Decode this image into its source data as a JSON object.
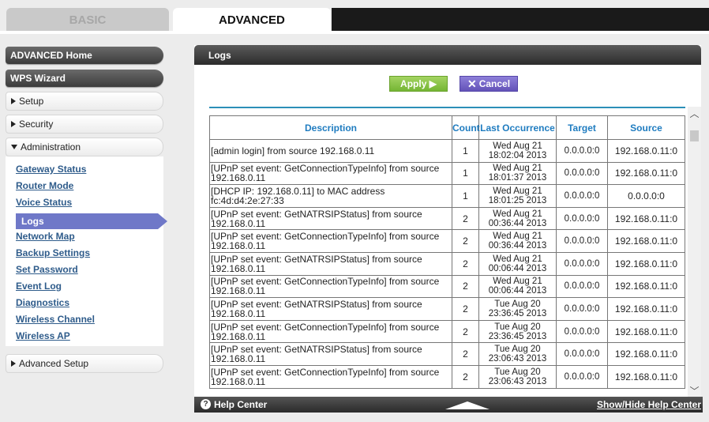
{
  "tabs": {
    "basic": "BASIC",
    "advanced": "ADVANCED"
  },
  "sidebar": {
    "advanced_home": "ADVANCED Home",
    "wps_wizard": "WPS Wizard",
    "setup": "Setup",
    "security": "Security",
    "administration": "Administration",
    "admin_items": [
      "Gateway Status",
      "Router Mode",
      "Voice Status",
      "Logs",
      "Network Map",
      "Backup Settings",
      "Set Password",
      "Event Log",
      "Diagnostics",
      "Wireless Channel",
      "Wireless AP"
    ],
    "active_item": "Logs",
    "advanced_setup": "Advanced Setup"
  },
  "main": {
    "title": "Logs",
    "apply_label": "Apply ▶",
    "cancel_label": "Cancel"
  },
  "table": {
    "headers": [
      "Description",
      "Count",
      "Last Occurrence",
      "Target",
      "Source"
    ],
    "rows": [
      [
        "[admin login] from source 192.168.0.11",
        "1",
        "Wed Aug 21 18:02:04 2013",
        "0.0.0.0:0",
        "192.168.0.11:0"
      ],
      [
        "[UPnP set event: GetConnectionTypeInfo] from source 192.168.0.11",
        "1",
        "Wed Aug 21 18:01:37 2013",
        "0.0.0.0:0",
        "192.168.0.11:0"
      ],
      [
        "[DHCP IP: 192.168.0.11] to MAC address fc:4d:d4:2e:27:33",
        "1",
        "Wed Aug 21 18:01:25 2013",
        "0.0.0.0:0",
        "0.0.0.0:0"
      ],
      [
        "[UPnP set event: GetNATRSIPStatus] from source 192.168.0.11",
        "2",
        "Wed Aug 21 00:36:44 2013",
        "0.0.0.0:0",
        "192.168.0.11:0"
      ],
      [
        "[UPnP set event: GetConnectionTypeInfo] from source 192.168.0.11",
        "2",
        "Wed Aug 21 00:36:44 2013",
        "0.0.0.0:0",
        "192.168.0.11:0"
      ],
      [
        "[UPnP set event: GetNATRSIPStatus] from source 192.168.0.11",
        "2",
        "Wed Aug 21 00:06:44 2013",
        "0.0.0.0:0",
        "192.168.0.11:0"
      ],
      [
        "[UPnP set event: GetConnectionTypeInfo] from source 192.168.0.11",
        "2",
        "Wed Aug 21 00:06:44 2013",
        "0.0.0.0:0",
        "192.168.0.11:0"
      ],
      [
        "[UPnP set event: GetNATRSIPStatus] from source 192.168.0.11",
        "2",
        "Tue Aug 20 23:36:45 2013",
        "0.0.0.0:0",
        "192.168.0.11:0"
      ],
      [
        "[UPnP set event: GetConnectionTypeInfo] from source 192.168.0.11",
        "2",
        "Tue Aug 20 23:36:45 2013",
        "0.0.0.0:0",
        "192.168.0.11:0"
      ],
      [
        "[UPnP set event: GetNATRSIPStatus] from source 192.168.0.11",
        "2",
        "Tue Aug 20 23:06:43 2013",
        "0.0.0.0:0",
        "192.168.0.11:0"
      ],
      [
        "[UPnP set event: GetConnectionTypeInfo] from source 192.168.0.11",
        "2",
        "Tue Aug 20 23:06:43 2013",
        "0.0.0.0:0",
        "192.168.0.11:0"
      ]
    ]
  },
  "footer": {
    "help_center": "Help Center",
    "show_hide": "Show/Hide Help Center"
  },
  "colors": {
    "header_text": "#1f7cc0",
    "active_nav": "#6f78c8",
    "apply_green": "#8cc84b",
    "cancel_purple": "#7565c9",
    "link_blue": "#2f5c8b"
  }
}
